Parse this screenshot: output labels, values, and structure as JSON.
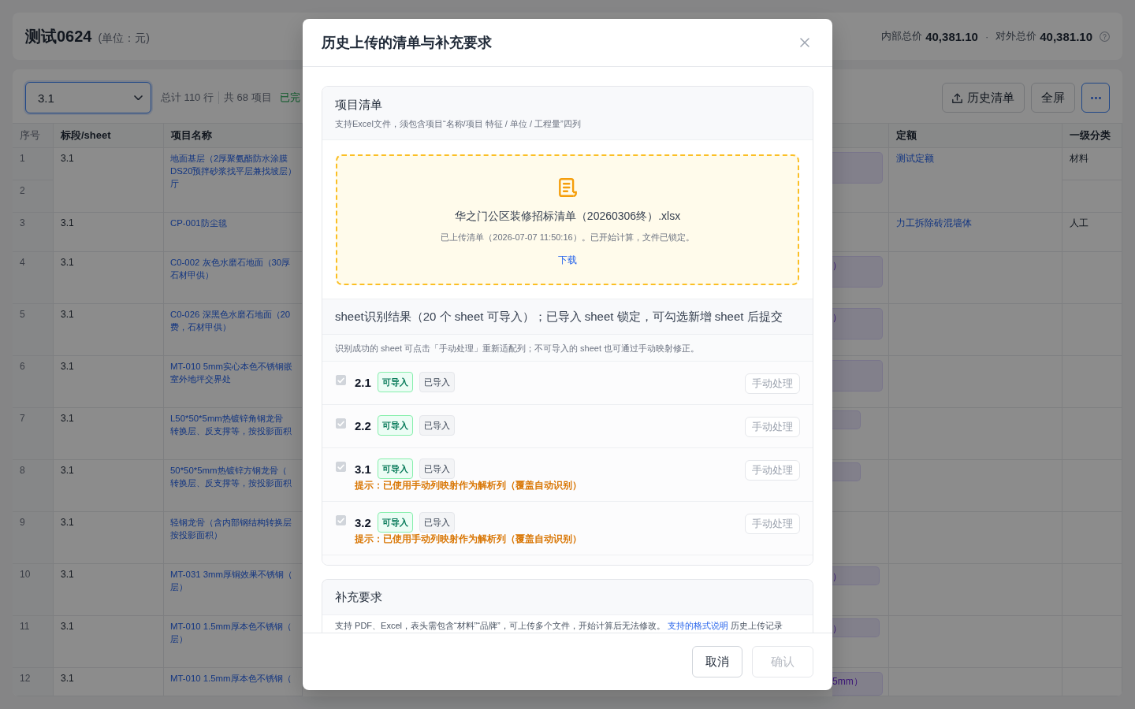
{
  "header": {
    "title": "测试0624",
    "unit": "(单位：元)",
    "totals": [
      {
        "label": "内部总价",
        "value": "40,381.10"
      },
      {
        "label": "对外总价",
        "value": "40,381.10"
      }
    ],
    "separator": "·"
  },
  "toolbar": {
    "sheet_select": {
      "value": "3.1",
      "focused": true
    },
    "stats": [
      "总计 110 行",
      "共 68 项目"
    ],
    "status": "已完",
    "buttons": [
      {
        "kind": "upload",
        "label": "历史清单"
      },
      {
        "kind": "plain",
        "label": "全屏"
      },
      {
        "kind": "more",
        "focused": true
      }
    ]
  },
  "table": {
    "columns": [
      "序号",
      "标段/sheet",
      "项目名称",
      "定额",
      "一级分类"
    ],
    "rows": [
      {
        "numbers": [
          "1",
          "2"
        ],
        "sheet": "3.1",
        "name": [
          "地面基层（2厚聚氨酯防水涂膜",
          "DS20预拌砂浆找平层兼找坡层）",
          "厅"
        ],
        "chip": {
          "kind": "tall"
        },
        "quota": "测试定额",
        "categories": [
          "材料"
        ]
      },
      {
        "numbers": [
          "3"
        ],
        "sheet": "3.1",
        "name": [
          "CP-001防尘毯"
        ],
        "quota": "力工拆除砖混墙体",
        "categories": [
          "人工"
        ]
      },
      {
        "numbers": [
          "4"
        ],
        "sheet": "3.1",
        "name": [
          "C0-002 灰色水磨石地面（30厚",
          "石材甲供）"
        ],
        "chip": {
          "kind": "tall",
          "text": "）"
        }
      },
      {
        "numbers": [
          "5"
        ],
        "sheet": "3.1",
        "name": [
          "C0-026 深黑色水磨石地面（20",
          "费，石材甲供）"
        ],
        "chip": {
          "kind": "tall",
          "text": "）"
        }
      },
      {
        "numbers": [
          "6"
        ],
        "sheet": "3.1",
        "name": [
          "MT-010 5mm实心本色不锈钢嵌",
          "室外地坪交界处"
        ],
        "chip": {
          "kind": "tall"
        }
      },
      {
        "numbers": [
          "7"
        ],
        "sheet": "3.1",
        "name": [
          "L50*50*5mm热镀锌角钢龙骨",
          "转换层、反支撑等，按投影面积"
        ],
        "chip": {
          "kind": "short"
        }
      },
      {
        "numbers": [
          "8"
        ],
        "sheet": "3.1",
        "name": [
          "50*50*5mm热镀锌方钢龙骨（",
          "转换层、反支撑等，按投影面积"
        ],
        "chip": {
          "kind": "short"
        }
      },
      {
        "numbers": [
          "9"
        ],
        "sheet": "3.1",
        "name": [
          "轻钢龙骨（含内部钢结构转换层",
          "按投影面积）"
        ]
      },
      {
        "numbers": [
          "10"
        ],
        "sheet": "3.1",
        "name": [
          "MT-031 3mm厚铜效果不锈钢（",
          "层）"
        ],
        "chip": {
          "kind": "medium",
          "text": "）"
        }
      },
      {
        "numbers": [
          "11"
        ],
        "sheet": "3.1",
        "name": [
          "MT-010 1.5mm厚本色不锈钢（",
          "层）"
        ],
        "chip": {
          "kind": "medium",
          "text": "）"
        }
      },
      {
        "numbers": [
          "12"
        ],
        "sheet": "3.1",
        "name": [
          "MT-010 1.5mm厚本色不锈钢（"
        ],
        "chip": {
          "kind": "tall",
          "text": "5mm）"
        }
      }
    ]
  },
  "modal": {
    "title": "历史上传的清单与补充要求",
    "project_list": {
      "title": "项目清单",
      "subtitle": "支持Excel文件，须包含项目“名称/项目 特征 / 单位 / 工程量”四列",
      "file": {
        "name": "华之门公区装修招标清单（20260306终）.xlsx",
        "status": "已上传清单（2026-07-07 11:50:16）。已开始计算，文件已锁定。",
        "download": "下载"
      }
    },
    "sheet_result": {
      "title": "sheet识别结果（20 个 sheet 可导入）；已导入 sheet 锁定，可勾选新增 sheet 后提交",
      "hint": "识别成功的 sheet 可点击「手动处理」重新适配列；不可导入的 sheet 也可通过手动映射修正。",
      "sheets": [
        {
          "name": "2.1",
          "checked": true,
          "disabled": true,
          "tags": [
            {
              "label": "可导入",
              "kind": "success"
            },
            {
              "label": "已导入",
              "kind": "neutral"
            }
          ],
          "action": {
            "label": "手动处理",
            "disabled": true
          }
        },
        {
          "name": "2.2",
          "checked": true,
          "disabled": true,
          "tags": [
            {
              "label": "可导入",
              "kind": "success"
            },
            {
              "label": "已导入",
              "kind": "neutral"
            }
          ],
          "action": {
            "label": "手动处理",
            "disabled": true
          }
        },
        {
          "name": "3.1",
          "checked": true,
          "disabled": true,
          "tags": [
            {
              "label": "可导入",
              "kind": "success"
            },
            {
              "label": "已导入",
              "kind": "neutral"
            }
          ],
          "action": {
            "label": "手动处理",
            "disabled": true
          },
          "note": "提示：已使用手动列映射作为解析列（覆盖自动识别）"
        },
        {
          "name": "3.2",
          "checked": true,
          "disabled": true,
          "tags": [
            {
              "label": "可导入",
              "kind": "success"
            },
            {
              "label": "已导入",
              "kind": "neutral"
            }
          ],
          "action": {
            "label": "手动处理",
            "disabled": true
          },
          "note": "提示：已使用手动列映射作为解析列（覆盖自动识别）"
        }
      ]
    },
    "supplement": {
      "title": "补充要求",
      "text": "支持 PDF、Excel，表头需包含“材料”“品牌”，可上传多个文件，开始计算后无法修改。",
      "link": "支持的格式说明",
      "trailing": "历史上传记录"
    },
    "buttons": [
      {
        "label": "取消",
        "kind": "default",
        "disabled": false
      },
      {
        "label": "确认",
        "kind": "primary",
        "disabled": true
      }
    ]
  }
}
